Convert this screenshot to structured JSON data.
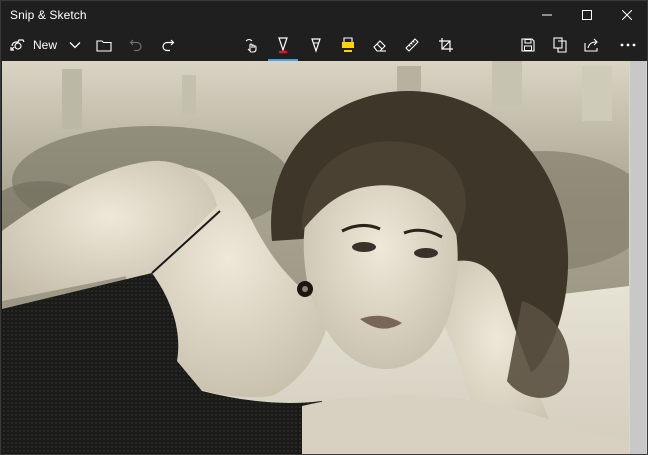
{
  "window": {
    "title": "Snip & Sketch"
  },
  "toolbar": {
    "new_label": "New",
    "active_tool": "ballpoint-pen",
    "accent_color": "#4aa3df",
    "pen_color": "#e81123",
    "highlighter_color": "#ffd400"
  },
  "canvas": {
    "image_description_icon": "photo",
    "tone": "sepia monochrome"
  }
}
